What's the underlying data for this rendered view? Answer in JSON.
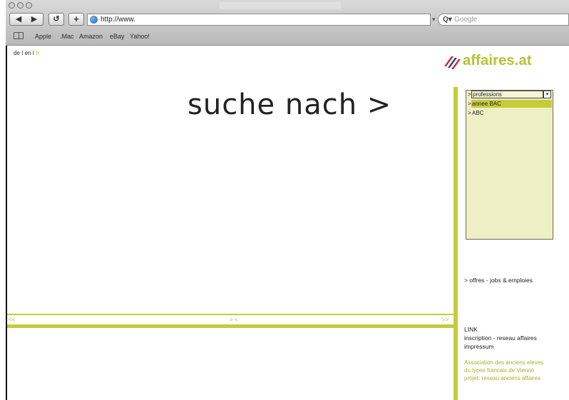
{
  "browser": {
    "nav_back": "◀",
    "nav_forward": "▶",
    "reload": "↺",
    "add": "+",
    "url": "http://www.",
    "search_placeholder": "Google",
    "search_icon": "Q▾",
    "bookmarks": [
      "Apple",
      ".Mac",
      "Amazon",
      "eBay",
      "Yahoo!"
    ]
  },
  "page": {
    "languages": {
      "de": "de",
      "sep1": "I",
      "en": "en",
      "sep2": "I",
      "fr": "fr"
    },
    "logo_text": "affaires.at",
    "headline": "suche nach >",
    "nav": {
      "prev": "<<",
      "mid": "> <",
      "next": ">>"
    },
    "list_panel": {
      "rows": [
        {
          "prefix": ">",
          "label": "professions"
        },
        {
          "prefix": ">",
          "label": "annee BAC"
        },
        {
          "prefix": ">",
          "label": "ABC"
        }
      ],
      "dropdown_icon": "▾"
    },
    "offres": "> offres - jobs & emploies",
    "link_title": "LINK",
    "inscription": "inscription - reseau affaires",
    "impressum": "impressum",
    "association": [
      "Association des anciens eleves",
      "du lycee francais de Vienne",
      "projet: reseau anciens affaires"
    ]
  },
  "colors": {
    "accent": "#c4cc3a",
    "logo_green": "#b7c230",
    "logo_red": "#d42a2a",
    "logo_blue": "#2a3f8a",
    "panel_bg": "#eeefc4"
  }
}
